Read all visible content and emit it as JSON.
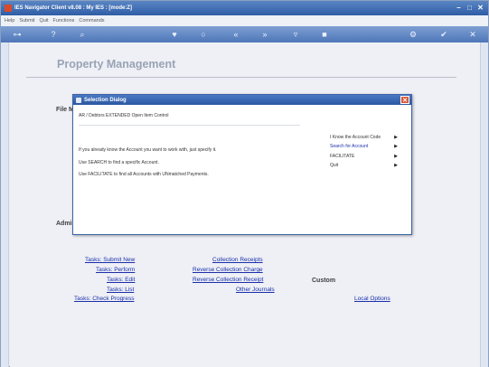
{
  "window": {
    "title": "IES Navigator Client v8.08 : My IES :       [mode:Z]"
  },
  "menu": [
    "Help",
    "Submit",
    "Quit",
    "Functions",
    "Commands"
  ],
  "page": {
    "title": "Property Management"
  },
  "sections": {
    "file": "File M",
    "admin": "Admi",
    "custom": "Custom"
  },
  "links": {
    "col1": [
      "Tasks: Submit New",
      "Tasks: Perform",
      "Tasks: Edit",
      "Tasks: List",
      "Tasks: Check Progress"
    ],
    "col2": [
      "Collection Receipts",
      "Reverse Collection Charge",
      "Reverse Collection Receipt",
      "Other Journals"
    ],
    "col3": [
      "Local Options"
    ]
  },
  "dialog": {
    "title": "Selection Dialog",
    "subtitle": "AR / Debtors EXTENDED Open Item Control",
    "lines": [
      "If you already know the Account you want to work with, just specify it.",
      "Use SEARCH to find a specific Account.",
      "Use FACILITATE to find all Accounts with UNmatched Payments."
    ],
    "options": [
      {
        "label": "I Know the Account Code",
        "active": false
      },
      {
        "label": "Search for Account",
        "active": true
      },
      {
        "label": "FACILITATE",
        "active": false
      },
      {
        "label": "Quit",
        "active": false
      }
    ]
  }
}
